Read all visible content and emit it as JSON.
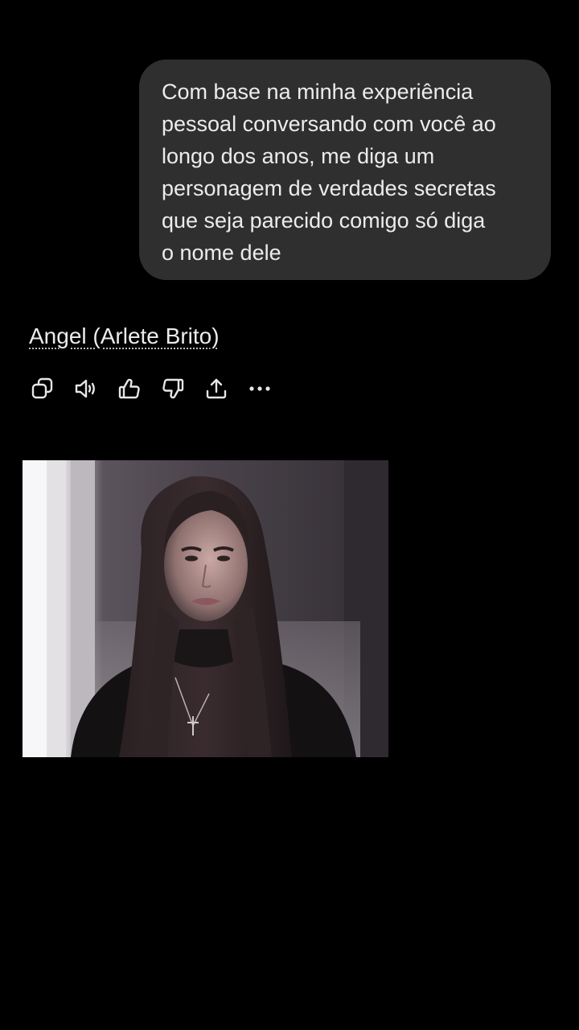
{
  "conversation": {
    "user_message": {
      "lines": [
        "Com base na minha experiência",
        "pessoal conversando com você ao",
        "longo dos anos, me diga um",
        "personagem de verdades secretas",
        "que seja parecido comigo só diga",
        "o nome dele"
      ]
    },
    "assistant_message": {
      "text": "Angel (Arlete Brito)"
    },
    "actions": [
      {
        "name": "copy",
        "icon": "copy-icon"
      },
      {
        "name": "read-aloud",
        "icon": "speaker-icon"
      },
      {
        "name": "good-response",
        "icon": "thumbs-up-icon"
      },
      {
        "name": "bad-response",
        "icon": "thumbs-down-icon"
      },
      {
        "name": "share",
        "icon": "share-icon"
      },
      {
        "name": "more",
        "icon": "more-dots-icon"
      }
    ]
  },
  "colors": {
    "background": "#000000",
    "bubble": "#2f2f2f",
    "text": "#ececec",
    "icon": "#e6e6e6"
  }
}
